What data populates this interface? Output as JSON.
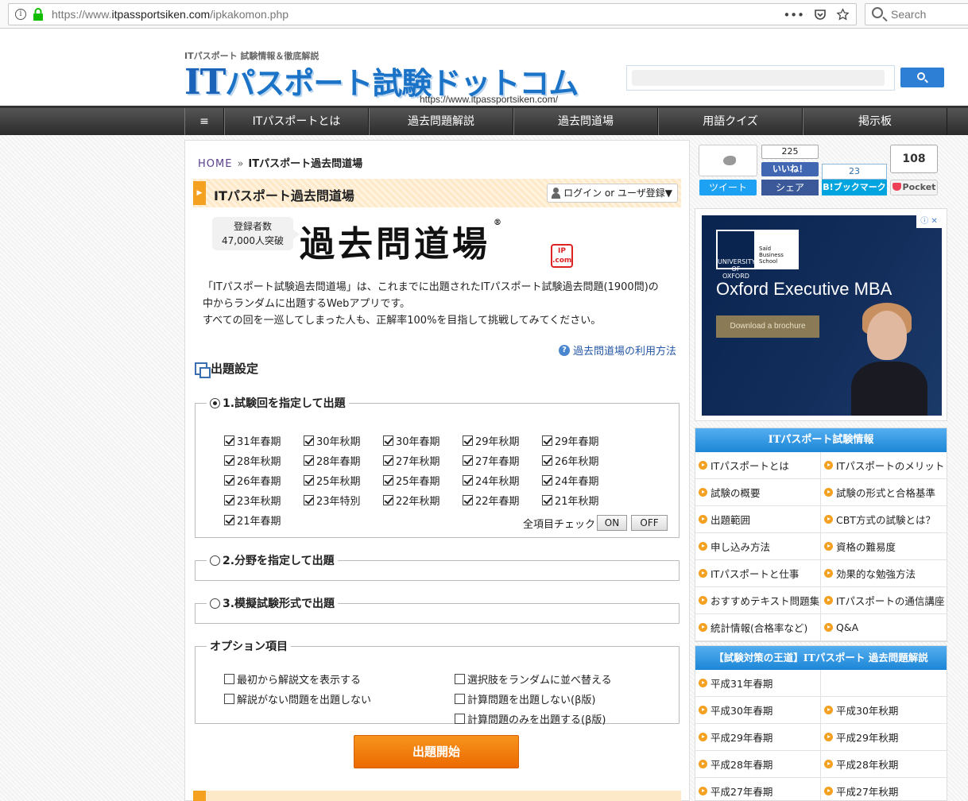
{
  "browser": {
    "url_prefix": "https://www.",
    "url_domain": "itpassportsiken.com",
    "url_path": "/ipkakomon.php",
    "overflow": "•••",
    "search_placeholder": "Search"
  },
  "header": {
    "tagline": "ITパスポート 試験情報＆徹底解説",
    "logo_it": "IT",
    "logo_rest": "パスポート試験ドットコム",
    "logo_url": "https://www.itpassportsiken.com/"
  },
  "nav": {
    "menu": "≡",
    "items": [
      "ITパスポートとは",
      "過去問題解説",
      "過去問道場",
      "用語クイズ",
      "掲示板"
    ]
  },
  "breadcrumb": {
    "home": "HOME",
    "sep": "»",
    "current": "ITパスポート過去問道場"
  },
  "title": {
    "text": "ITパスポート過去問道場",
    "login": "ログイン or ユーザ登録▼"
  },
  "badge": {
    "line1": "登録者数",
    "line2": "47,000人突破"
  },
  "dojo": {
    "name": "過去問道場",
    "reg": "®",
    "ip_line1": "IP",
    "ip_line2": ".com"
  },
  "intro": {
    "line1": "「ITパスポート試験過去問道場」は、これまでに出題されたITパスポート試験過去問題(1900問)の",
    "line2": "中からランダムに出題するWebアプリです。",
    "line3": "すべての回を一巡してしまった人も、正解率100%を目指して挑戦してみてください。"
  },
  "howto": {
    "icon": "?",
    "text": "過去問道場の利用方法"
  },
  "settings": {
    "heading": "出題設定",
    "mode1": "1.試験回を指定して出題",
    "mode2": "2.分野を指定して出題",
    "mode3": "3.模擬試験形式で出題",
    "periods": [
      "31年春期",
      "30年秋期",
      "30年春期",
      "29年秋期",
      "29年春期",
      "28年秋期",
      "28年春期",
      "27年秋期",
      "27年春期",
      "26年秋期",
      "26年春期",
      "25年秋期",
      "25年春期",
      "24年秋期",
      "24年春期",
      "23年秋期",
      "23年特別",
      "22年秋期",
      "22年春期",
      "21年秋期",
      "21年春期"
    ],
    "all_check": "全項目チェック",
    "on": "ON",
    "off": "OFF"
  },
  "options": {
    "legend": "オプション項目",
    "items": [
      "最初から解説文を表示する",
      "選択肢をランダムに並べ替える",
      "解説がない問題を出題しない",
      "計算問題を出題しない(β版)",
      "",
      "計算問題のみを出題する(β版)"
    ]
  },
  "start_button": "出題開始",
  "social": {
    "tweet": "ツイート",
    "fb_count": "225",
    "fb_like": "いいね！",
    "fb_share": "シェア",
    "hb_count": "23",
    "hb_label": "B!ブックマーク",
    "pocket_count": "108",
    "pocket_label": "Pocket"
  },
  "ad": {
    "school_a": "UNIVERSITY OF OXFORD",
    "school_b_1": "Saïd",
    "school_b_2": "Business",
    "school_b_3": "School",
    "title": "Oxford Executive MBA",
    "cta": "Download a brochure",
    "choices": "ⓘ ✕"
  },
  "info_panel": {
    "heading": "ITパスポート試験情報",
    "items": [
      "ITパスポートとは",
      "ITパスポートのメリット",
      "試験の概要",
      "試験の形式と合格基準",
      "出題範囲",
      "CBT方式の試験とは？",
      "申し込み方法",
      "資格の難易度",
      "ITパスポートと仕事",
      "効果的な勉強方法",
      "おすすめテキスト問題集",
      "ITパスポートの通信講座",
      "統計情報(合格率など)",
      "Q&A"
    ]
  },
  "kako_panel": {
    "heading": "【試験対策の王道】ITパスポート 過去問題解説",
    "items": [
      "平成31年春期",
      "",
      "平成30年春期",
      "平成30年秋期",
      "平成29年春期",
      "平成29年秋期",
      "平成28年春期",
      "平成28年秋期",
      "平成27年春期",
      "平成27年秋期"
    ]
  }
}
